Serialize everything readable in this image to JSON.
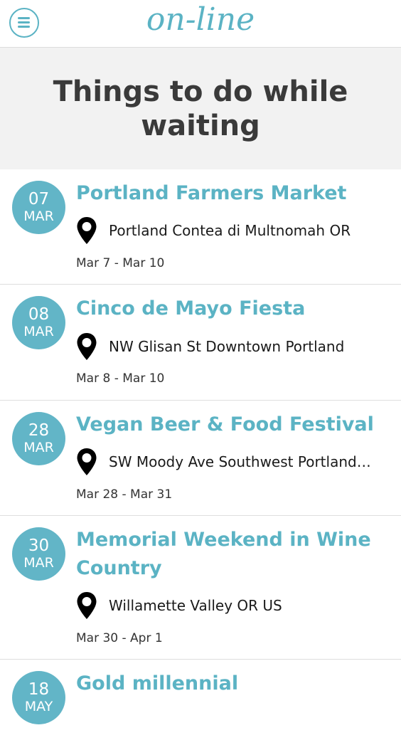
{
  "header": {
    "logo": "on-line",
    "menu_icon": "hamburger-menu-icon"
  },
  "hero": {
    "title": "Things to do while waiting"
  },
  "colors": {
    "accent": "#5bb3c4",
    "badge": "#62b5c7",
    "hero_bg": "#f2f2f2"
  },
  "events": [
    {
      "day": "07",
      "month": "MAR",
      "title": "Portland Farmers Market",
      "location": "Portland Contea di Multnomah OR",
      "dates": "Mar 7 - Mar 10"
    },
    {
      "day": "08",
      "month": "MAR",
      "title": "Cinco de Mayo Fiesta",
      "location": "NW Glisan St Downtown Portland",
      "dates": "Mar 8 - Mar 10"
    },
    {
      "day": "28",
      "month": "MAR",
      "title": "Vegan Beer & Food Festival",
      "location": "SW Moody Ave Southwest Portland…",
      "dates": "Mar 28 - Mar 31"
    },
    {
      "day": "30",
      "month": "MAR",
      "title": "Memorial Weekend in Wine Country",
      "location": "Willamette Valley OR US",
      "dates": "Mar 30 - Apr 1"
    },
    {
      "day": "18",
      "month": "MAY",
      "title": "Gold millennial",
      "location": "",
      "dates": ""
    }
  ]
}
